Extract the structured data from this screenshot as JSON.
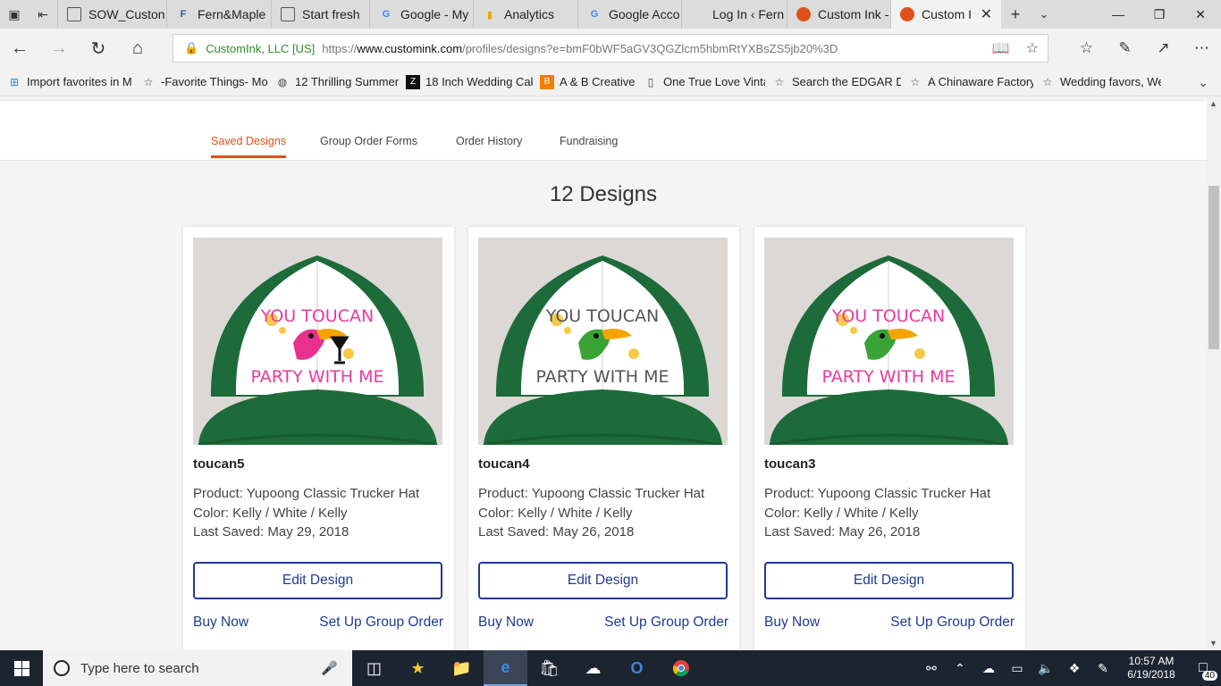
{
  "browser": {
    "tabs": [
      {
        "label": "SOW_Custon",
        "icon": "page-icon",
        "color": "#555555"
      },
      {
        "label": "Fern&Maple",
        "icon": "fernmaple-icon",
        "color": "#2a5db0"
      },
      {
        "label": "Start fresh",
        "icon": "page-icon",
        "color": "#555555"
      },
      {
        "label": "Google - My",
        "icon": "google-icon",
        "color": "#4285f4"
      },
      {
        "label": "Analytics",
        "icon": "analytics-icon",
        "color": "#f4a400"
      },
      {
        "label": "Google Acco",
        "icon": "google-icon",
        "color": "#4285f4"
      },
      {
        "label": "Log In ‹ Fern",
        "icon": "blank-icon",
        "color": "#ffffff"
      },
      {
        "label": "Custom Ink -",
        "icon": "customink-icon",
        "color": "#e0501b"
      },
      {
        "label": "Custom I",
        "icon": "customink-icon",
        "color": "#e0501b",
        "active": true
      }
    ],
    "address": {
      "org": "CustomInk, LLC [US]",
      "scheme": "https://",
      "host": "www.customink.com",
      "path": "/profiles/designs?e=bmF0bWF5aGV3QGZlcm5hbmRtYXBsZS5jb20%3D"
    },
    "favorites": [
      {
        "label": "Import favorites in M",
        "icon": "windows-icon"
      },
      {
        "label": "-Favorite Things- Mo",
        "icon": "star-icon"
      },
      {
        "label": "12 Thrilling Summer V",
        "icon": "globe-icon"
      },
      {
        "label": "18 Inch Wedding Cak",
        "icon": "z-icon"
      },
      {
        "label": "A & B Creative",
        "icon": "blogger-icon"
      },
      {
        "label": "One True Love Vintag",
        "icon": "blank-page-icon"
      },
      {
        "label": "Search the EDGAR Da",
        "icon": "star-icon"
      },
      {
        "label": "A Chinaware Factory",
        "icon": "star-icon"
      },
      {
        "label": "Wedding favors, Wed",
        "icon": "star-icon"
      }
    ]
  },
  "subnav": {
    "tabs": [
      {
        "label": "Saved Designs",
        "active": true
      },
      {
        "label": "Group Order Forms"
      },
      {
        "label": "Order History"
      },
      {
        "label": "Fundraising"
      }
    ]
  },
  "heading": "12 Designs",
  "cards": [
    {
      "name": "toucan5",
      "product": "Product: Yupoong Classic Trucker Hat",
      "color": "Color: Kelly / White / Kelly",
      "saved": "Last Saved: May 29, 2018",
      "edit": "Edit Design",
      "buy": "Buy Now",
      "group": "Set Up Group Order",
      "art": {
        "line1": "YOU TOUCAN",
        "line2": "PARTY WITH ME",
        "textColor": "#e83aa0",
        "birdColor": "#e8308f"
      }
    },
    {
      "name": "toucan4",
      "product": "Product: Yupoong Classic Trucker Hat",
      "color": "Color: Kelly / White / Kelly",
      "saved": "Last Saved: May 26, 2018",
      "edit": "Edit Design",
      "buy": "Buy Now",
      "group": "Set Up Group Order",
      "art": {
        "line1": "YOU TOUCAN",
        "line2": "PARTY WITH ME",
        "textColor": "#555555",
        "birdColor": "#3aa335"
      }
    },
    {
      "name": "toucan3",
      "product": "Product: Yupoong Classic Trucker Hat",
      "color": "Color: Kelly / White / Kelly",
      "saved": "Last Saved: May 26, 2018",
      "edit": "Edit Design",
      "buy": "Buy Now",
      "group": "Set Up Group Order",
      "art": {
        "line1": "YOU TOUCAN",
        "line2": "PARTY WITH ME",
        "textColor": "#e83aa0",
        "birdColor": "#3aa335"
      }
    }
  ],
  "taskbar": {
    "search_placeholder": "Type here to search",
    "time": "10:57 AM",
    "date": "6/19/2018",
    "notifications": "40"
  },
  "colors": {
    "accent": "#e0501b",
    "link": "#1f3b8f",
    "hat_green": "#1d6b3a"
  }
}
